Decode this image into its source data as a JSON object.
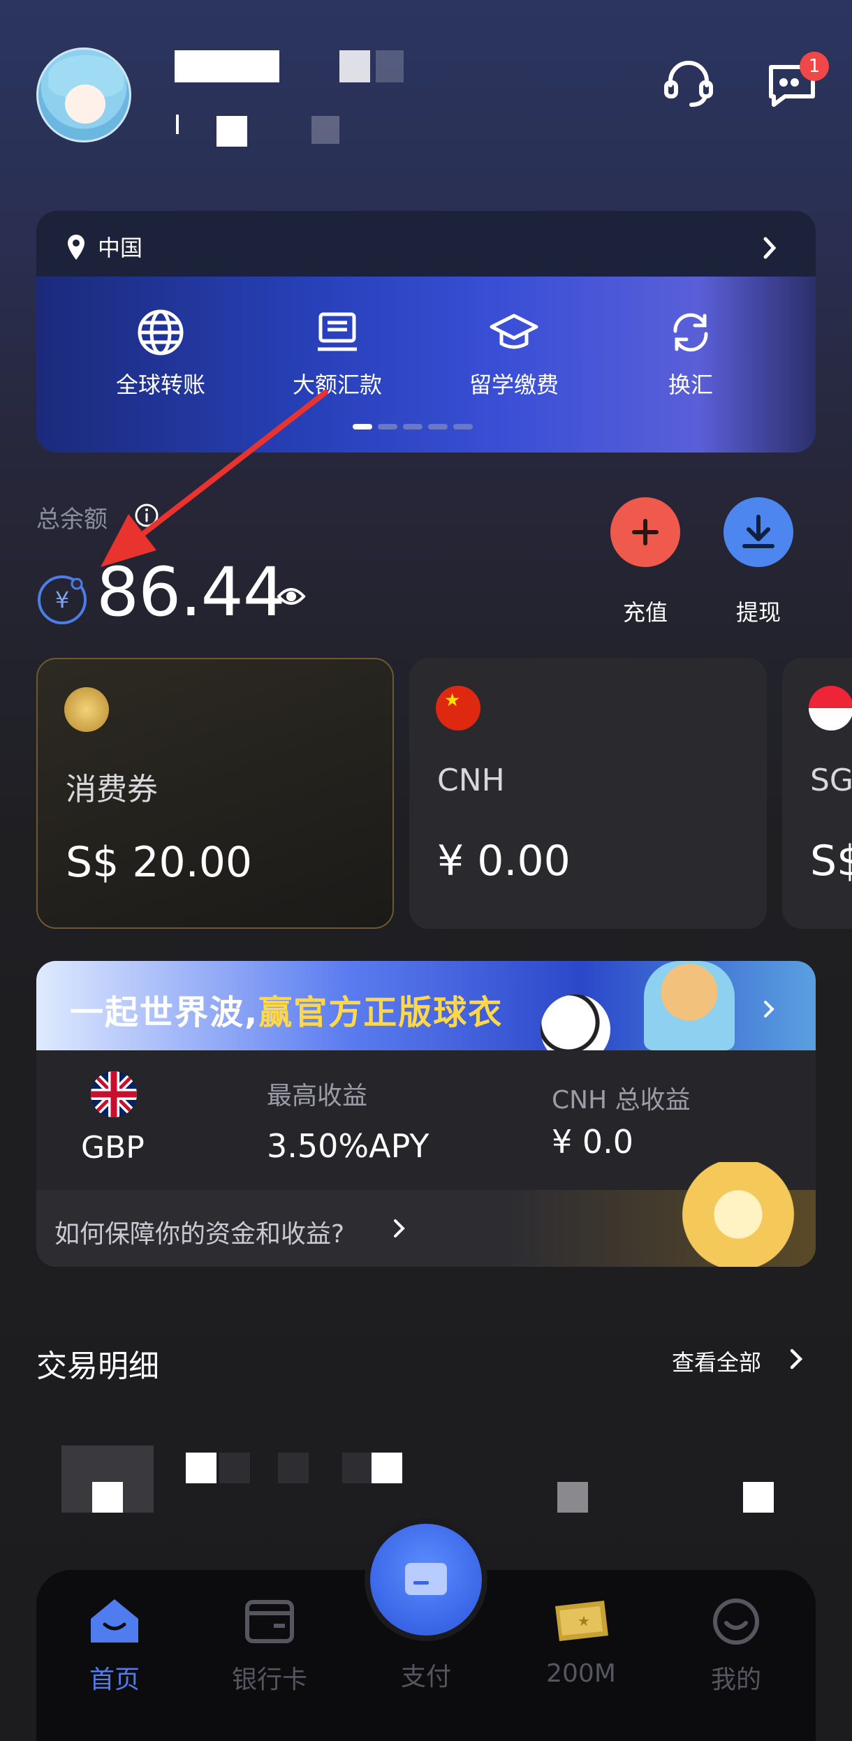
{
  "header": {
    "notification_count": "1"
  },
  "region": {
    "name": "中国"
  },
  "quick_actions": [
    {
      "label": "全球转账",
      "icon": "globe-icon"
    },
    {
      "label": "大额汇款",
      "icon": "large-transfer-icon"
    },
    {
      "label": "留学缴费",
      "icon": "graduation-cap-icon"
    },
    {
      "label": "换汇",
      "icon": "exchange-icon"
    }
  ],
  "balance": {
    "label": "总余额",
    "currency_symbol": "¥",
    "amount": "86.44"
  },
  "actions": {
    "topup_label": "充值",
    "withdraw_label": "提现"
  },
  "wallets": [
    {
      "name": "消费券",
      "amount": "S$ 20.00",
      "icon": "voucher-icon"
    },
    {
      "name": "CNH",
      "amount": "¥ 0.00",
      "icon": "china-flag-icon"
    },
    {
      "name": "SG",
      "amount": "S$",
      "icon": "singapore-flag-icon"
    }
  ],
  "banner": {
    "text_a": "一起世界波,",
    "text_b": "赢官方正版球衣"
  },
  "earnings": {
    "currency": "GBP",
    "max_label": "最高收益",
    "max_value": "3.50%APY",
    "total_label": "CNH 总收益",
    "total_value": "¥ 0.0",
    "help_text": "如何保障你的资金和收益?"
  },
  "transactions": {
    "title": "交易明细",
    "view_all": "查看全部"
  },
  "nav": [
    {
      "label": "首页",
      "active": true
    },
    {
      "label": "银行卡",
      "active": false
    },
    {
      "label": "支付",
      "active": false
    },
    {
      "label": "200M",
      "active": false
    },
    {
      "label": "我的",
      "active": false
    }
  ],
  "colors": {
    "accent_blue": "#4f7df0",
    "topup_red": "#ef5a4c",
    "withdraw_blue": "#4c86ee",
    "arrow_red": "#e8332f"
  }
}
